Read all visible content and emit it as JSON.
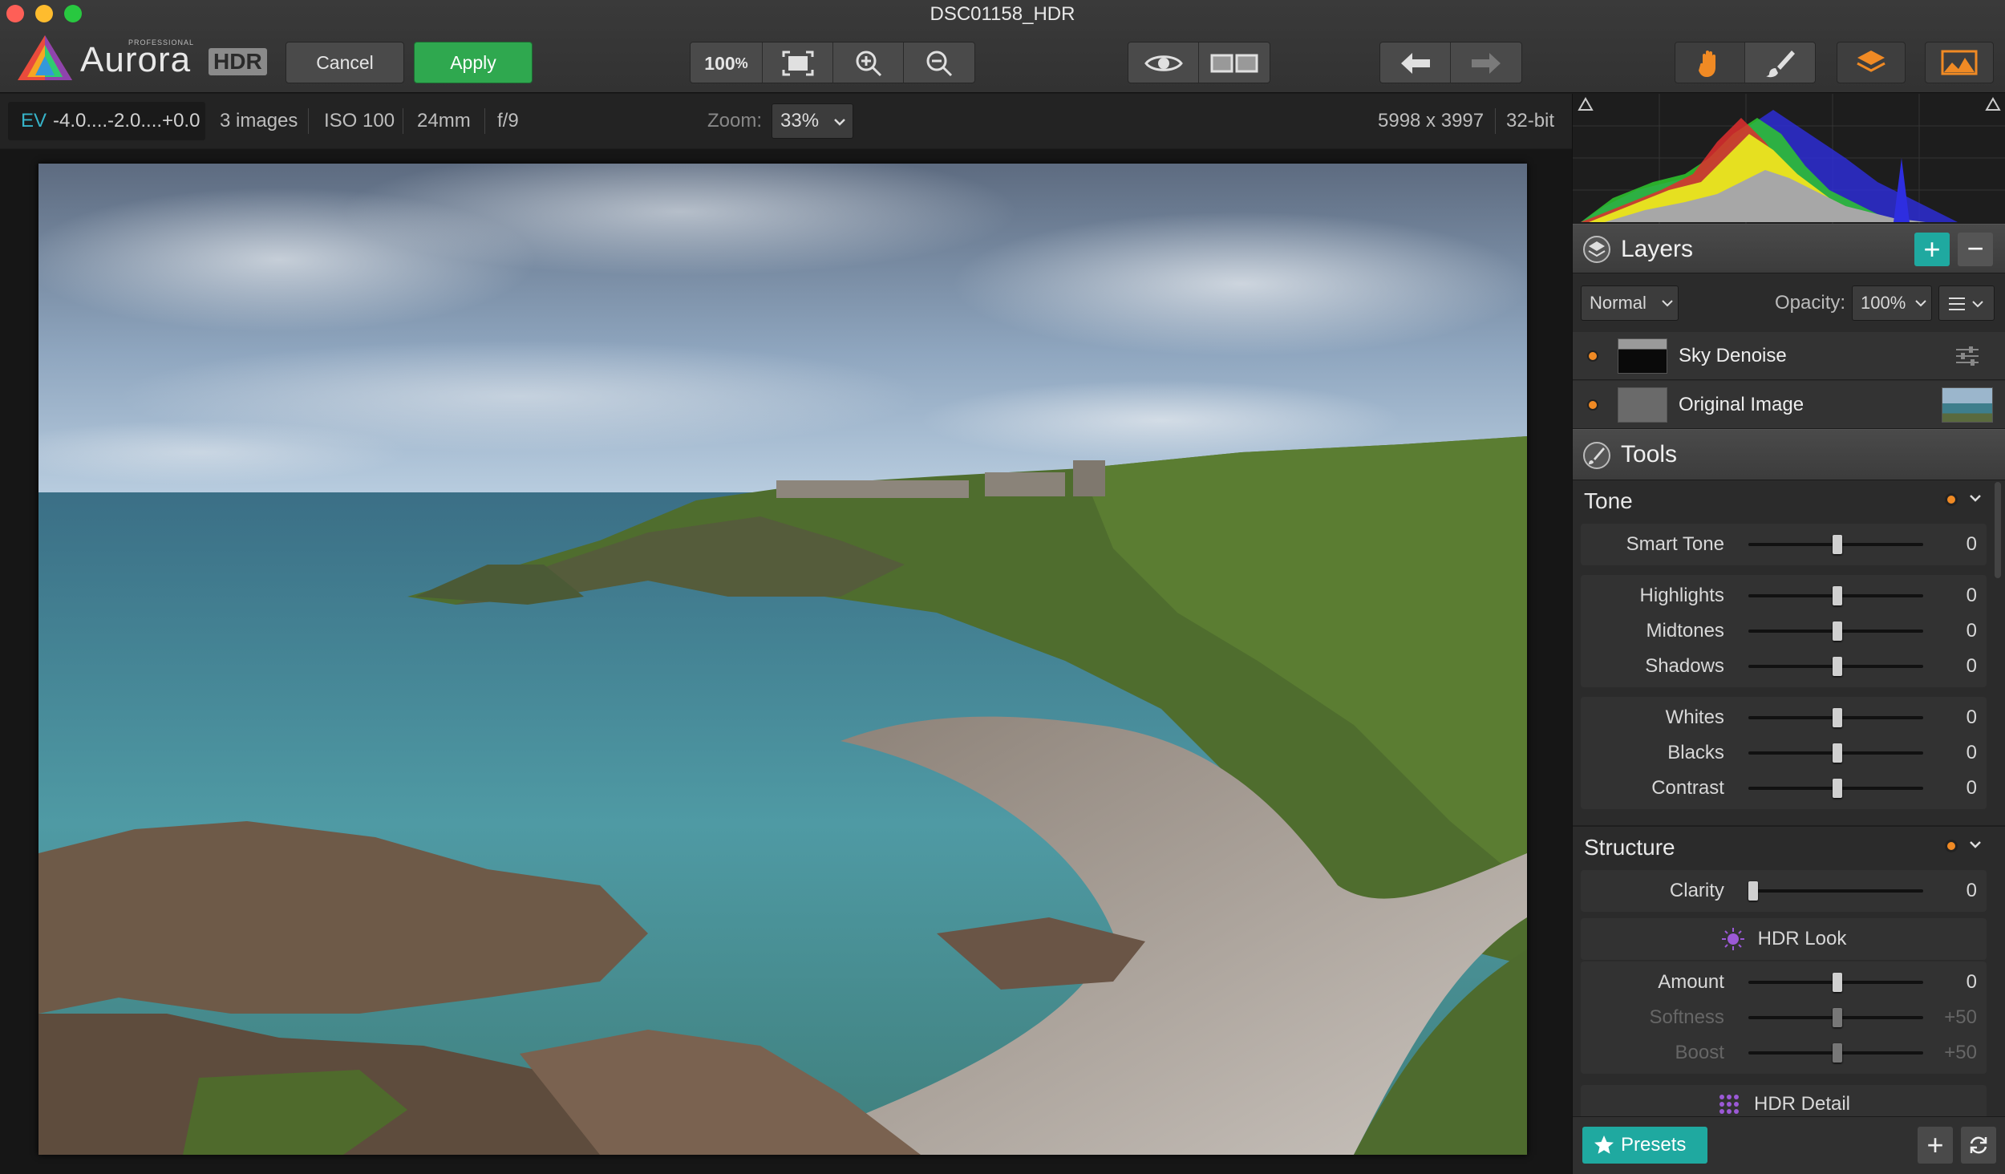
{
  "window": {
    "title": "DSC01158_HDR"
  },
  "toolbar": {
    "logo_professional": "PROFESSIONAL",
    "logo_name": "Aurora",
    "logo_suffix": "HDR",
    "cancel_label": "Cancel",
    "apply_label": "Apply",
    "zoom_100_label": "100",
    "zoom_100_unit": "%"
  },
  "infobar": {
    "ev_label": "EV",
    "ev_value": "-4.0....-2.0....+0.0",
    "images": "3 images",
    "iso": "ISO 100",
    "focal": "24mm",
    "aperture": "f/9",
    "zoom_label": "Zoom:",
    "zoom_value": "33%",
    "dimensions": "5998 x 3997",
    "bit_depth": "32-bit"
  },
  "layers": {
    "title": "Layers",
    "blend_mode": "Normal",
    "opacity_label": "Opacity:",
    "opacity_value": "100%",
    "items": [
      {
        "name": "Sky Denoise"
      },
      {
        "name": "Original Image"
      }
    ]
  },
  "tools": {
    "title": "Tools",
    "tone": {
      "title": "Tone",
      "smart_tone": {
        "label": "Smart Tone",
        "value": "0",
        "position": 0.5
      },
      "highlights": {
        "label": "Highlights",
        "value": "0",
        "position": 0.5
      },
      "midtones": {
        "label": "Midtones",
        "value": "0",
        "position": 0.5
      },
      "shadows": {
        "label": "Shadows",
        "value": "0",
        "position": 0.5
      },
      "whites": {
        "label": "Whites",
        "value": "0",
        "position": 0.5
      },
      "blacks": {
        "label": "Blacks",
        "value": "0",
        "position": 0.5
      },
      "contrast": {
        "label": "Contrast",
        "value": "0",
        "position": 0.5
      }
    },
    "structure": {
      "title": "Structure",
      "clarity": {
        "label": "Clarity",
        "value": "0",
        "position": 0.0
      },
      "hdr_look": {
        "title": "HDR Look",
        "amount": {
          "label": "Amount",
          "value": "0",
          "position": 0.5
        },
        "softness": {
          "label": "Softness",
          "value": "+50",
          "position": 0.5
        },
        "boost": {
          "label": "Boost",
          "value": "+50",
          "position": 0.5
        }
      },
      "hdr_detail_title": "HDR Detail"
    }
  },
  "footer": {
    "presets_label": "Presets"
  },
  "colors": {
    "accent_green": "#2fa84f",
    "teal": "#1fa9a0",
    "orange": "#f08a24",
    "panel": "#2b2b2b"
  }
}
